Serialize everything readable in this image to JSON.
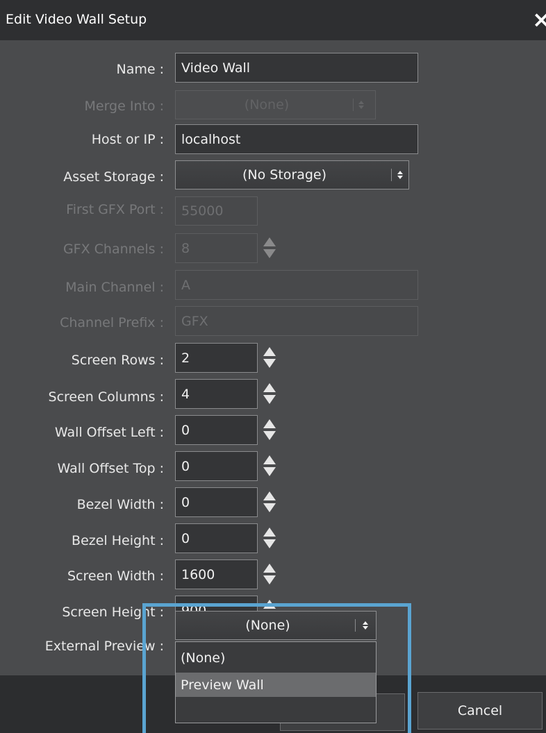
{
  "window": {
    "title": "Edit Video Wall Setup",
    "close_glyph": "×"
  },
  "form": {
    "name": {
      "label": "Name :",
      "value": "Video Wall"
    },
    "merge_into": {
      "label": "Merge Into :",
      "value": "(None)"
    },
    "host": {
      "label": "Host or IP :",
      "value": "localhost"
    },
    "asset_storage": {
      "label": "Asset Storage :",
      "value": "(No Storage)"
    },
    "first_gfx_port": {
      "label": "First GFX Port :",
      "value": "55000"
    },
    "gfx_channels": {
      "label": "GFX Channels :",
      "value": "8"
    },
    "main_channel": {
      "label": "Main Channel :",
      "value": "A"
    },
    "channel_prefix": {
      "label": "Channel Prefix :",
      "value": "GFX"
    },
    "screen_rows": {
      "label": "Screen Rows :",
      "value": "2"
    },
    "screen_columns": {
      "label": "Screen Columns :",
      "value": "4"
    },
    "wall_offset_left": {
      "label": "Wall Offset Left :",
      "value": "0"
    },
    "wall_offset_top": {
      "label": "Wall Offset Top :",
      "value": "0"
    },
    "bezel_width": {
      "label": "Bezel Width :",
      "value": "0"
    },
    "bezel_height": {
      "label": "Bezel Height :",
      "value": "0"
    },
    "screen_width": {
      "label": "Screen Width :",
      "value": "1600"
    },
    "screen_height": {
      "label": "Screen Height :",
      "value": "900"
    },
    "external_preview": {
      "label": "External Preview :",
      "value": "(None)"
    }
  },
  "dropdown": {
    "options": [
      "(None)",
      "Preview Wall"
    ],
    "hovered": "Preview Wall"
  },
  "footer": {
    "cancel_label": "Cancel"
  },
  "icons": {
    "close": "close-icon",
    "spinner": "spinner-arrows-icon",
    "dropdown": "chevron-updown-icon"
  },
  "colors": {
    "titlebar": "#2e2f31",
    "body": "#4a4b4d",
    "highlight": "#5aa4d1"
  }
}
